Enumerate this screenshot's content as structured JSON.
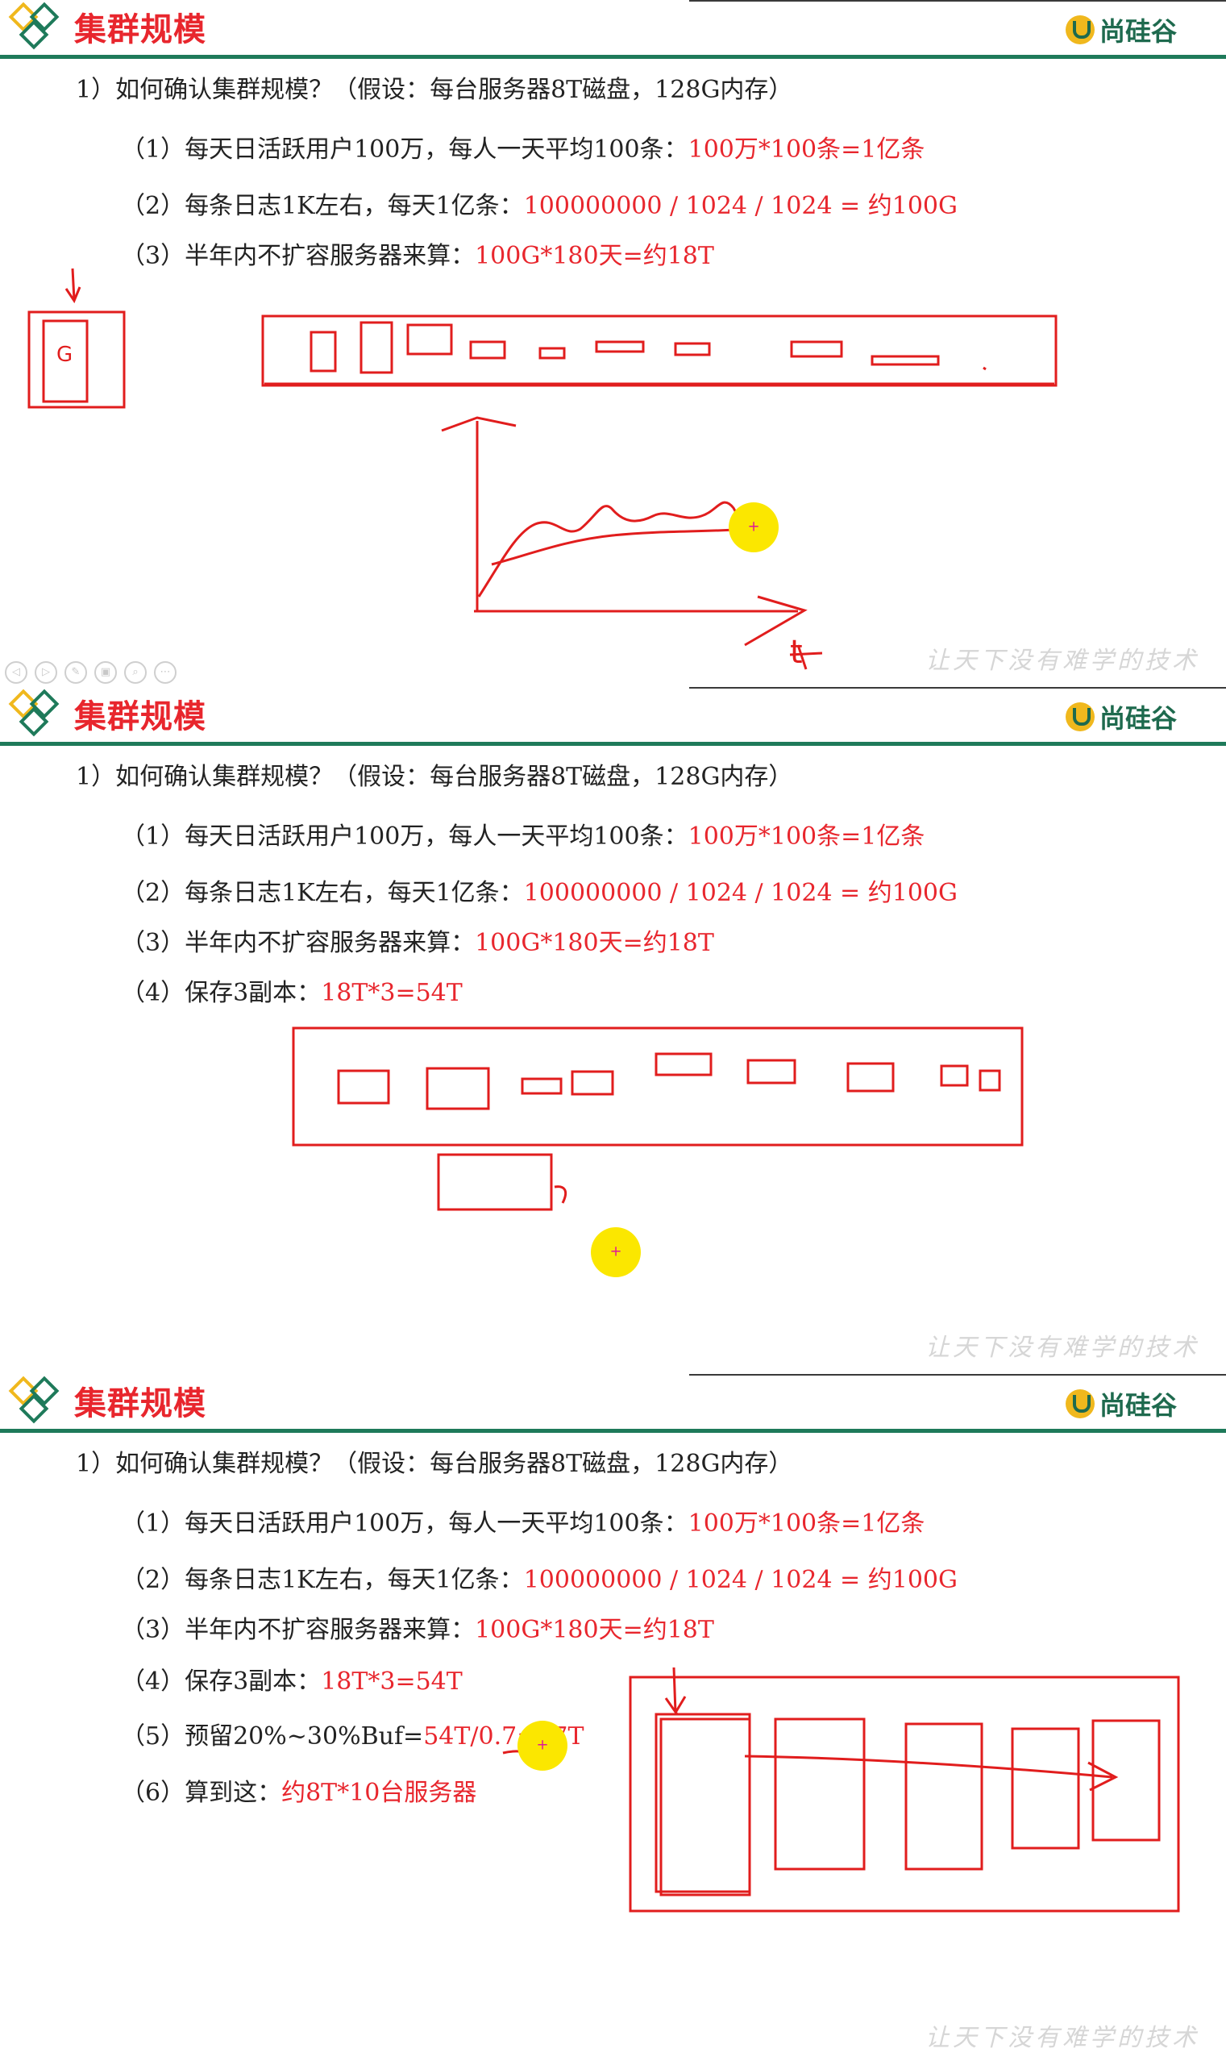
{
  "slides": [
    {
      "title": "集群规模",
      "brand": "尚硅谷",
      "question": "1）如何确认集群规模？（假设：每台服务器8T磁盘，128G内存）",
      "items": [
        {
          "label": "（1）每天日活跃用户100万，每人一天平均100条：",
          "value": "100万*100条=1亿条"
        },
        {
          "label": "（2）每条日志1K左右，每天1亿条：",
          "value": "100000000 / 1024 / 1024 = 约100G"
        },
        {
          "label": "（3）半年内不扩容服务器来算：",
          "value": "100G*180天=约18T"
        }
      ],
      "sketch_text": {
        "g": "G",
        "t": "t"
      },
      "watermark": "让天下没有难学的技术",
      "controls": [
        "◁",
        "▷",
        "✎",
        "▣",
        "⌕",
        "⋯"
      ]
    },
    {
      "title": "集群规模",
      "brand": "尚硅谷",
      "question": "1）如何确认集群规模？（假设：每台服务器8T磁盘，128G内存）",
      "items": [
        {
          "label": "（1）每天日活跃用户100万，每人一天平均100条：",
          "value": "100万*100条=1亿条"
        },
        {
          "label": "（2）每条日志1K左右，每天1亿条：",
          "value": "100000000 / 1024 / 1024 = 约100G"
        },
        {
          "label": "（3）半年内不扩容服务器来算：",
          "value": "100G*180天=约18T"
        },
        {
          "label": "（4）保存3副本：",
          "value": "18T*3=54T"
        }
      ],
      "watermark": "让天下没有难学的技术"
    },
    {
      "title": "集群规模",
      "brand": "尚硅谷",
      "question": "1）如何确认集群规模？（假设：每台服务器8T磁盘，128G内存）",
      "items": [
        {
          "label": "（1）每天日活跃用户100万，每人一天平均100条：",
          "value": "100万*100条=1亿条"
        },
        {
          "label": "（2）每条日志1K左右，每天1亿条：",
          "value": "100000000 / 1024 / 1024 = 约100G"
        },
        {
          "label": "（3）半年内不扩容服务器来算：",
          "value": "100G*180天=约18T"
        },
        {
          "label": "（4）保存3副本：",
          "value": "18T*3=54T"
        },
        {
          "label": "（5）预留20%~30%Buf=",
          "value": "54T/0.7=77T"
        },
        {
          "label": "（6）算到这：",
          "value": "约8T*10台服务器"
        }
      ],
      "watermark": "让天下没有难学的技术"
    }
  ],
  "colors": {
    "accent": "#e8262d",
    "brand_green": "#1e7a5a",
    "highlight": "#fbe700"
  },
  "icons": [
    "diamond-logo-icon",
    "brand-u-icon",
    "highlight-cursor-icon"
  ]
}
